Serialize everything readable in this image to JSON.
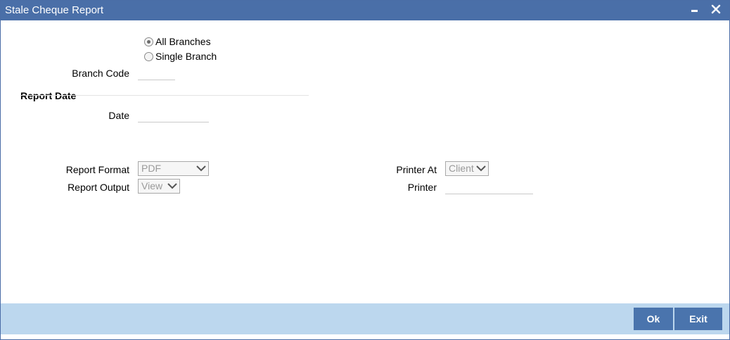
{
  "window": {
    "title": "Stale Cheque Report"
  },
  "branch": {
    "options": [
      "All Branches",
      "Single Branch"
    ],
    "selected": "All Branches",
    "code_label": "Branch Code",
    "code_value": ""
  },
  "report_date": {
    "section_title": "Report Date",
    "date_label": "Date",
    "date_value": ""
  },
  "report": {
    "format_label": "Report Format",
    "format_value": "PDF",
    "output_label": "Report Output",
    "output_value": "View",
    "printer_at_label": "Printer At",
    "printer_at_value": "Client",
    "printer_label": "Printer",
    "printer_value": ""
  },
  "footer": {
    "ok_label": "Ok",
    "exit_label": "Exit"
  },
  "colors": {
    "titlebar": "#4a6fa8",
    "footer": "#bcd7ee",
    "button": "#4a74ad"
  },
  "icons": {
    "minimize": "minimize-icon",
    "close": "close-icon",
    "dropdown": "chevron-down-icon"
  }
}
